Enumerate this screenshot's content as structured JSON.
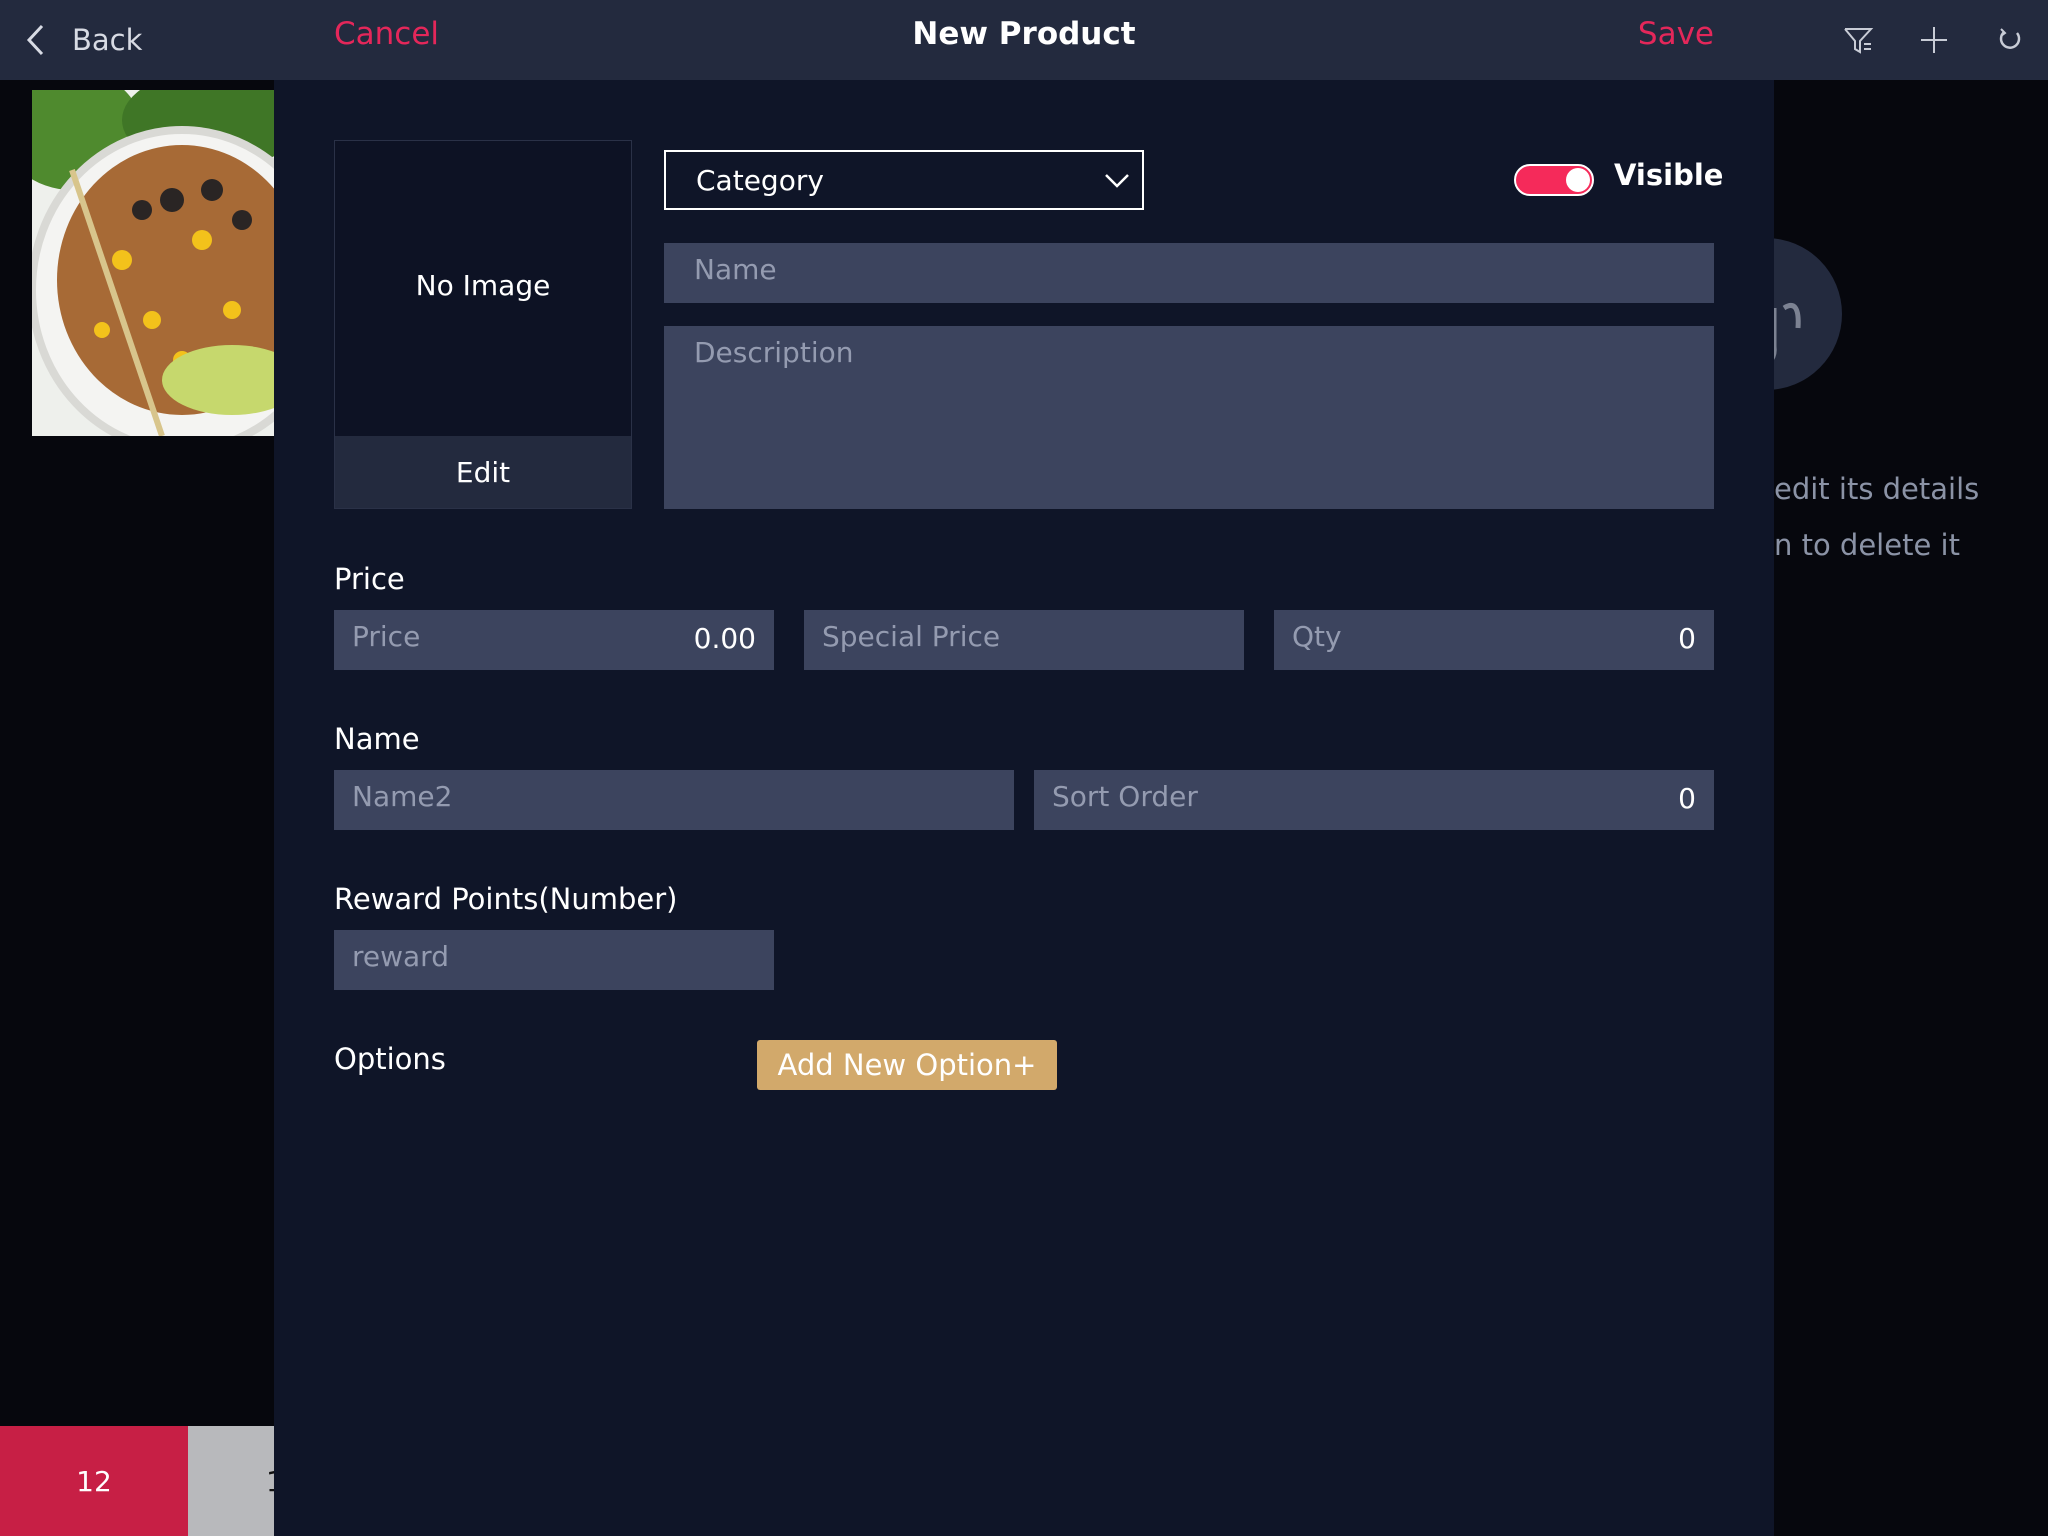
{
  "background": {
    "back_label": "Back",
    "tools": [
      "filter-icon",
      "plus-icon",
      "refresh-icon"
    ],
    "hint_line1": "edit its details",
    "hint_line2": "n to delete it",
    "bottom_tabs": [
      {
        "label": "12",
        "color": "#c71f45"
      },
      {
        "label": "1",
        "color": "#b8b9bc"
      }
    ]
  },
  "modal": {
    "title": "New Product",
    "cancel_label": "Cancel",
    "save_label": "Save",
    "image": {
      "placeholder": "No Image",
      "edit_label": "Edit"
    },
    "category": {
      "label": "Category"
    },
    "visible": {
      "label": "Visible",
      "on": true
    },
    "name_placeholder": "Name",
    "description_placeholder": "Description",
    "price_section": {
      "label": "Price",
      "price_placeholder": "Price",
      "price_value": "0.00",
      "special_price_placeholder": "Special Price",
      "qty_placeholder": "Qty",
      "qty_value": "0"
    },
    "name_section": {
      "label": "Name",
      "name2_placeholder": "Name2",
      "sort_order_placeholder": "Sort Order",
      "sort_order_value": "0"
    },
    "reward_section": {
      "label": "Reward Points(Number)",
      "reward_placeholder": "reward"
    },
    "options_section": {
      "label": "Options",
      "add_option_label": "Add New Option+"
    }
  },
  "colors": {
    "accent": "#e4275a",
    "toggle_on": "#f52a5a",
    "header_bg": "#232a3e",
    "modal_bg": "#0f1528",
    "field_bg": "#3c445e",
    "option_button": "#d2a96b"
  }
}
